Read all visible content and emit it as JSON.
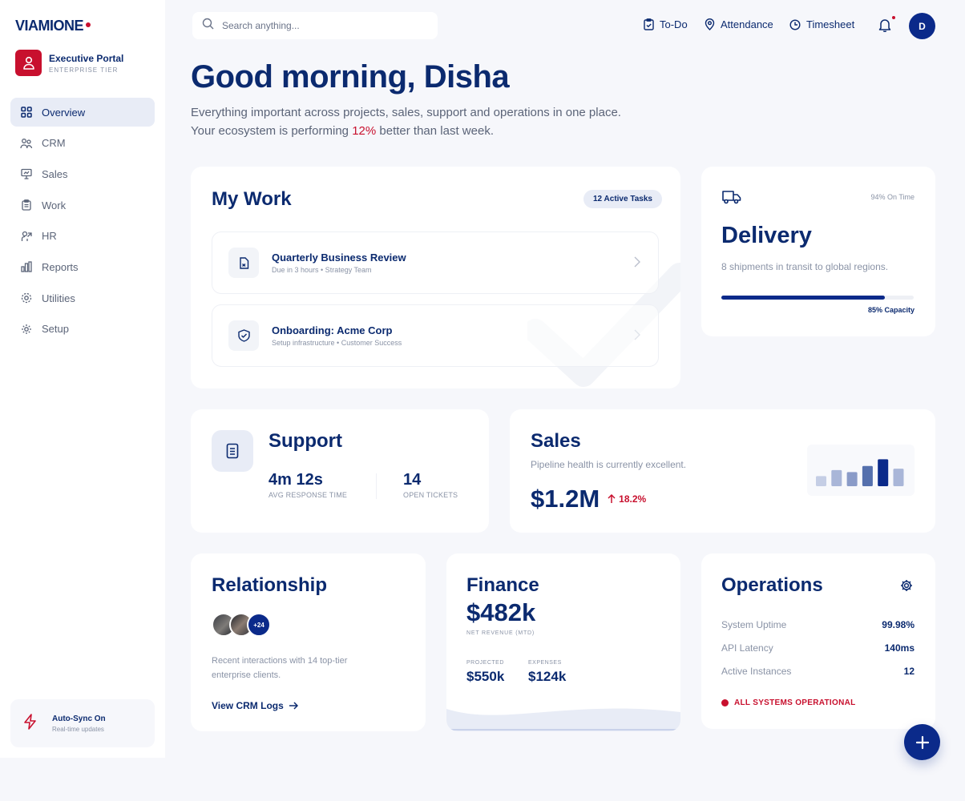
{
  "brand": {
    "name": "VIAMIONE",
    "accent": "#c8102e",
    "primary": "#0b2a6f"
  },
  "portal": {
    "title": "Executive Portal",
    "subtitle": "ENTERPRISE TIER"
  },
  "nav": {
    "items": [
      {
        "label": "Overview",
        "icon": "grid-icon",
        "active": true
      },
      {
        "label": "CRM",
        "icon": "users-icon"
      },
      {
        "label": "Sales",
        "icon": "presentation-icon"
      },
      {
        "label": "Work",
        "icon": "clipboard-icon"
      },
      {
        "label": "HR",
        "icon": "people-icon"
      },
      {
        "label": "Reports",
        "icon": "bar-chart-icon"
      },
      {
        "label": "Utilities",
        "icon": "cog-icon"
      },
      {
        "label": "Setup",
        "icon": "gear-icon"
      }
    ]
  },
  "autosync": {
    "title": "Auto-Sync On",
    "subtitle": "Real-time updates"
  },
  "search": {
    "placeholder": "Search anything..."
  },
  "topnav": {
    "todo": "To-Do",
    "attendance": "Attendance",
    "timesheet": "Timesheet"
  },
  "user": {
    "initial": "D"
  },
  "hero": {
    "greeting": "Good morning, Disha",
    "sub_before": "Everything important across projects, sales, support and operations in one place. Your ecosystem is performing ",
    "sub_highlight": "12%",
    "sub_after": " better than last week."
  },
  "mywork": {
    "title": "My Work",
    "badge": "12 Active Tasks",
    "tasks": [
      {
        "title": "Quarterly Business Review",
        "sub": "Due in 3 hours • Strategy Team",
        "icon": "document-icon"
      },
      {
        "title": "Onboarding: Acme Corp",
        "sub": "Setup infrastructure • Customer Success",
        "icon": "shield-check-icon"
      }
    ]
  },
  "delivery": {
    "title": "Delivery",
    "ontime": "94% On Time",
    "desc": "8 shipments in transit to global regions.",
    "capacity_label": "85% Capacity",
    "capacity": 0.85
  },
  "support": {
    "title": "Support",
    "avg_response": "4m 12s",
    "avg_response_label": "AVG RESPONSE TIME",
    "open_tickets": "14",
    "open_tickets_label": "OPEN TICKETS"
  },
  "sales": {
    "title": "Sales",
    "desc": "Pipeline health is currently excellent.",
    "value": "$1.2M",
    "change": "18.2%",
    "bars": [
      0.3,
      0.48,
      0.42,
      0.6,
      0.8,
      0.52
    ]
  },
  "relationship": {
    "title": "Relationship",
    "more": "+24",
    "desc": "Recent interactions with 14 top-tier enterprise clients.",
    "link": "View CRM Logs"
  },
  "finance": {
    "title": "Finance",
    "value": "$482k",
    "value_label": "NET REVENUE (MTD)",
    "projected_label": "PROJECTED",
    "projected": "$550k",
    "expenses_label": "EXPENSES",
    "expenses": "$124k"
  },
  "operations": {
    "title": "Operations",
    "rows": [
      {
        "k": "System Uptime",
        "v": "99.98%"
      },
      {
        "k": "API Latency",
        "v": "140ms"
      },
      {
        "k": "Active Instances",
        "v": "12"
      }
    ],
    "status": "ALL SYSTEMS OPERATIONAL"
  }
}
